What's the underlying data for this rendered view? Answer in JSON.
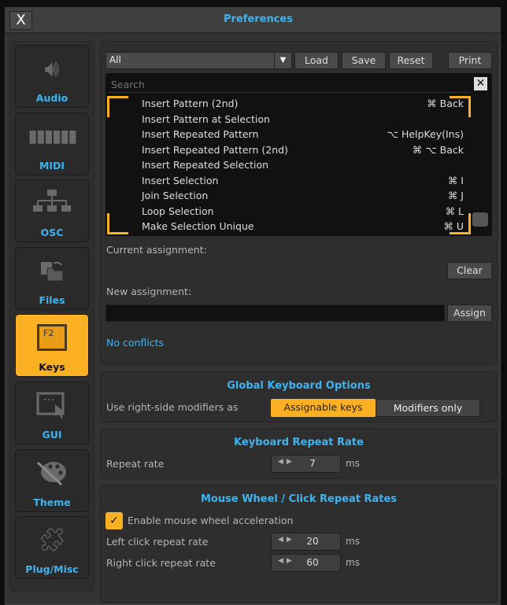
{
  "window": {
    "title": "Preferences",
    "close_label": "X"
  },
  "sidebar": {
    "items": [
      {
        "label": "Audio",
        "icon": "speaker-icon",
        "active": false
      },
      {
        "label": "MIDI",
        "icon": "piano-keys-icon",
        "active": false
      },
      {
        "label": "OSC",
        "icon": "network-tree-icon",
        "active": false
      },
      {
        "label": "Files",
        "icon": "folder-icon",
        "active": false
      },
      {
        "label": "Keys",
        "icon": "f2-key-icon",
        "active": true,
        "icon_text": "F2"
      },
      {
        "label": "GUI",
        "icon": "window-cursor-icon",
        "active": false
      },
      {
        "label": "Theme",
        "icon": "palette-icon",
        "active": false
      },
      {
        "label": "Plug/Misc",
        "icon": "puzzle-icon",
        "active": false
      }
    ]
  },
  "keys": {
    "filter_value": "All",
    "load": "Load",
    "save": "Save",
    "reset": "Reset",
    "print": "Print",
    "search_placeholder": "Search",
    "bindings": [
      {
        "action": "Insert Pattern (2nd)",
        "shortcut": "⌘ Back"
      },
      {
        "action": "Insert Pattern at Selection",
        "shortcut": ""
      },
      {
        "action": "Insert Repeated Pattern",
        "shortcut": "⌥ HelpKey(Ins)"
      },
      {
        "action": "Insert Repeated Pattern (2nd)",
        "shortcut": "⌘ ⌥ Back"
      },
      {
        "action": "Insert Repeated Selection",
        "shortcut": ""
      },
      {
        "action": "Insert Selection",
        "shortcut": "⌘ I"
      },
      {
        "action": "Join Selection",
        "shortcut": "⌘ J"
      },
      {
        "action": "Loop Selection",
        "shortcut": "⌘ L"
      },
      {
        "action": "Make Selection Unique",
        "shortcut": "⌘ U"
      }
    ],
    "current_assignment_label": "Current assignment:",
    "clear": "Clear",
    "new_assignment_label": "New assignment:",
    "new_assignment_value": "",
    "assign": "Assign",
    "conflicts": "No conflicts"
  },
  "global": {
    "title": "Global Keyboard Options",
    "modifiers_label": "Use right-side modifiers as",
    "options": [
      "Assignable keys",
      "Modifiers only"
    ],
    "selected": "Assignable keys"
  },
  "repeat": {
    "title": "Keyboard Repeat Rate",
    "label": "Repeat rate",
    "value": "7",
    "unit": "ms"
  },
  "mouse": {
    "title": "Mouse Wheel / Click Repeat Rates",
    "accel_label": "Enable mouse wheel acceleration",
    "accel_checked": true,
    "left_label": "Left click repeat rate",
    "left_value": "20",
    "right_label": "Right click repeat rate",
    "right_value": "60",
    "unit": "ms"
  },
  "colors": {
    "accent": "#3db4f0",
    "active": "#fbb123"
  }
}
